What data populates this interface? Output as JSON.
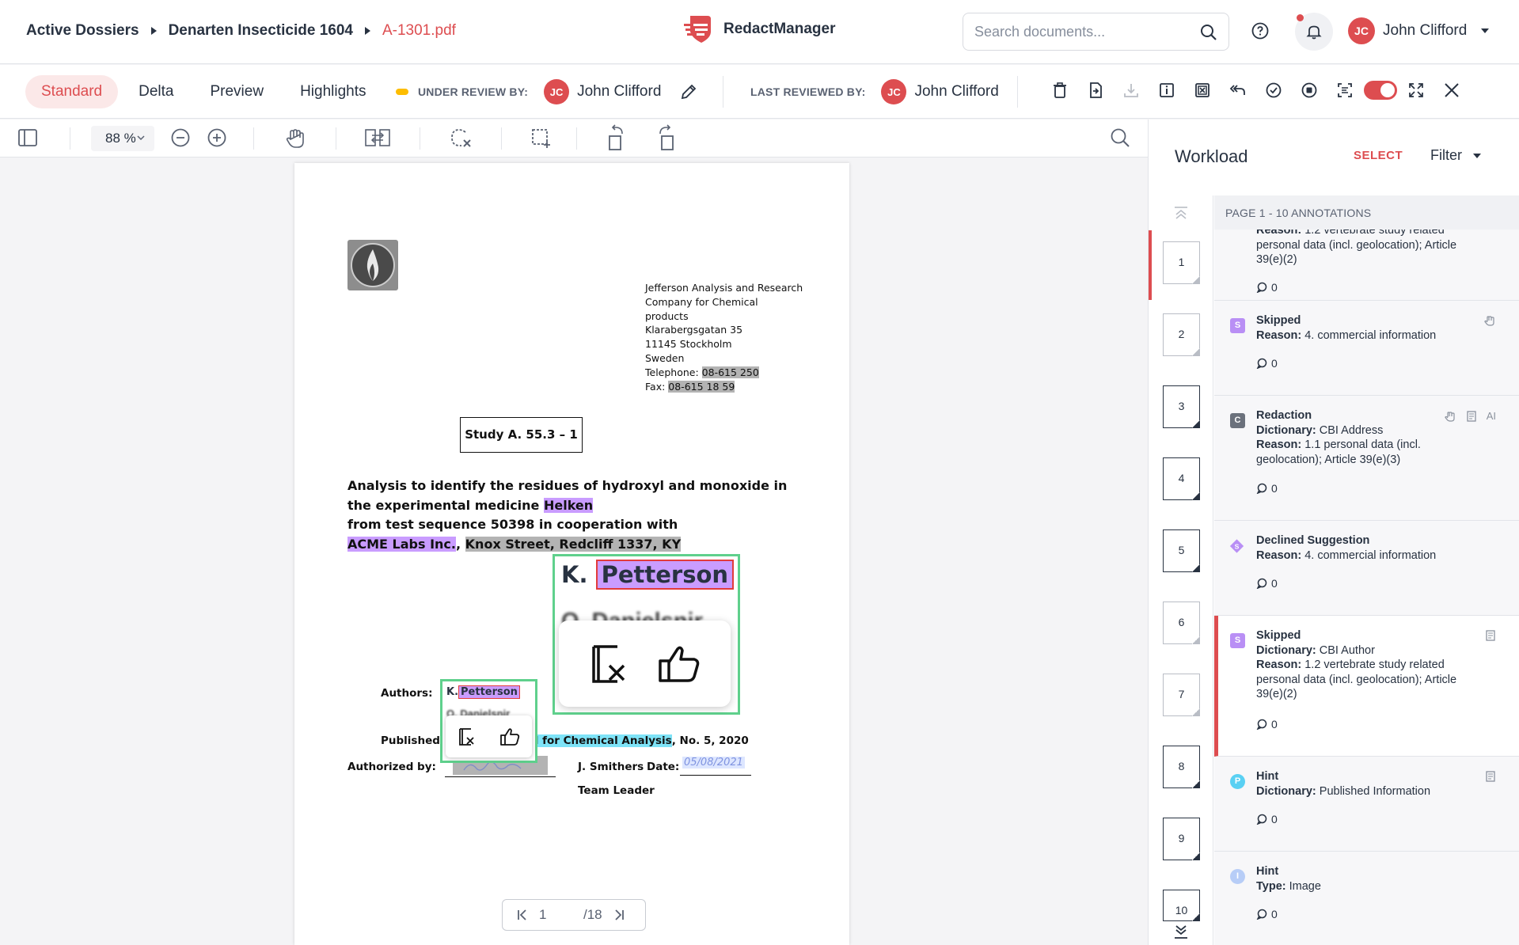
{
  "breadcrumb": {
    "items": [
      "Active Dossiers",
      "Denarten Insecticide 1604"
    ],
    "current": "A-1301.pdf"
  },
  "brand": {
    "name": "RedactManager"
  },
  "search": {
    "placeholder": "Search documents..."
  },
  "user": {
    "initials": "JC",
    "name": "John Clifford"
  },
  "view_tabs": [
    "Standard",
    "Delta",
    "Preview",
    "Highlights"
  ],
  "review": {
    "under_label": "UNDER REVIEW BY:",
    "under_initials": "JC",
    "under_name": "John Clifford",
    "last_label": "LAST REVIEWED BY:",
    "last_initials": "JC",
    "last_name": "John Clifford"
  },
  "toolbar": {
    "zoom": "88 %"
  },
  "document": {
    "address": [
      "Jefferson Analysis and Research",
      "Company for Chemical",
      "products",
      "Klarabergsgatan 35",
      "11145 Stockholm",
      "Sweden"
    ],
    "tel_label": "Telephone: ",
    "tel": "08-615 250",
    "fax_label": "Fax: ",
    "fax": "08-615 18 59",
    "study": "Study A. 55.3 – 1",
    "title_l1": "Analysis to identify the residues of hydroxyl and monoxide in",
    "title_l2a": "the experimental medicine ",
    "title_l2b": "Helken",
    "title_l3": "from test sequence 50398 in cooperation with",
    "title_l4a": "ACME Labs Inc.",
    "title_l4b": ", ",
    "title_l4c": "Knox Street, Redcliff 1337, KY",
    "authors_label": "Authors:",
    "author1_prefix": "K.",
    "author1": "Petterson",
    "published_label": "Published i",
    "journal": "ral for Chemical Analysis",
    "published_rest": ", No. 5, 2020",
    "authorized_label": "Authorized by:",
    "signer": "J. Smithers",
    "date_label": "Date:",
    "date_value": "05/08/2021",
    "signer_role": "Team Leader",
    "blur_text": "O. Danielsnir"
  },
  "pager": {
    "current": "1",
    "total": "/18"
  },
  "workload": {
    "title": "Workload",
    "select": "SELECT",
    "filter": "Filter",
    "header": "PAGE 1 - 10 ANNOTATIONS",
    "pages": [
      "1",
      "2",
      "3",
      "4",
      "5",
      "6",
      "7",
      "8",
      "9",
      "10"
    ],
    "annotations": [
      {
        "type": "",
        "line1": "",
        "reason": "Reason:",
        "reason_text": " 1.2 vertebrate study related personal data (incl. geolocation); Article 39(e)(2)",
        "comments": "0"
      },
      {
        "type": "Skipped",
        "icon": "S",
        "reason": "Reason:",
        "reason_text": " 4. commercial information",
        "comments": "0"
      },
      {
        "type": "Redaction",
        "icon": "C",
        "dict": "Dictionary:",
        "dict_text": " CBI Address",
        "reason": "Reason:",
        "reason_text": " 1.1 personal data (incl. geolocation); Article 39(e)(3)",
        "ai": "AI",
        "comments": "0"
      },
      {
        "type": "Declined Suggestion",
        "icon": "S",
        "reason": "Reason:",
        "reason_text": " 4. commercial information",
        "comments": "0"
      },
      {
        "type": "Skipped",
        "icon": "S",
        "dict": "Dictionary:",
        "dict_text": " CBI Author",
        "reason": "Reason:",
        "reason_text": " 1.2 vertebrate study related personal data (incl. geolocation); Article 39(e)(2)",
        "comments": "0"
      },
      {
        "type": "Hint",
        "icon": "P",
        "dict": "Dictionary:",
        "dict_text": " Published Information",
        "comments": "0"
      },
      {
        "type": "Hint",
        "icon": "I",
        "dict": "Type:",
        "dict_text": " Image",
        "comments": "0"
      }
    ]
  },
  "colors": {
    "accent": "#dd4d50",
    "skipped": "#b98ff5",
    "redaction": "#6b717c",
    "hint_p": "#59d0f3",
    "hint_i": "#b7cdf7",
    "lens": "#5fd08c"
  }
}
